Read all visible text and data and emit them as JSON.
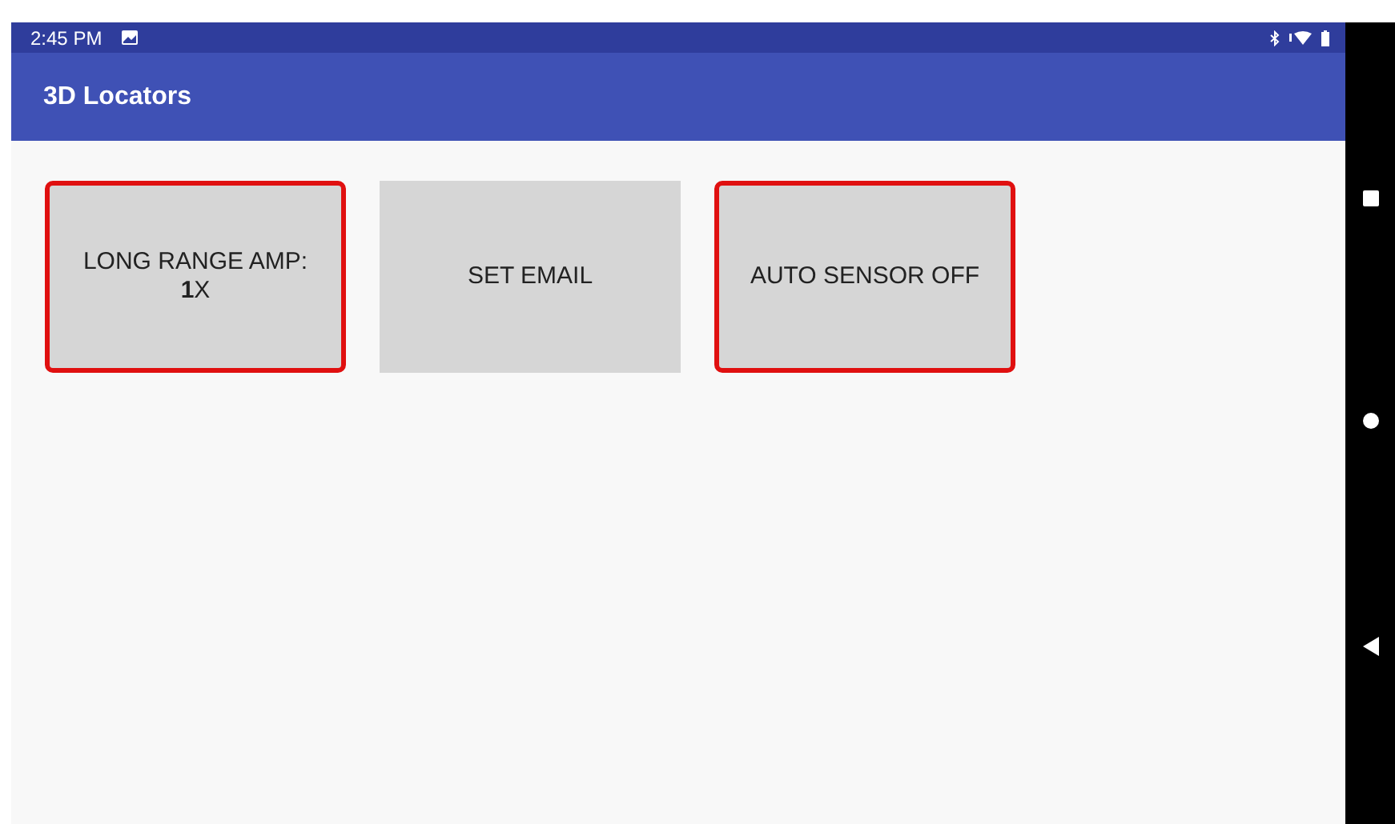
{
  "status_bar": {
    "time": "2:45 PM"
  },
  "app_bar": {
    "title": "3D Locators"
  },
  "buttons": [
    {
      "lines": [
        "LONG RANGE AMP:",
        "**1**X"
      ],
      "highlighted": true
    },
    {
      "lines": [
        "SET EMAIL"
      ],
      "highlighted": false
    },
    {
      "lines": [
        "AUTO SENSOR OFF"
      ],
      "highlighted": true
    }
  ]
}
